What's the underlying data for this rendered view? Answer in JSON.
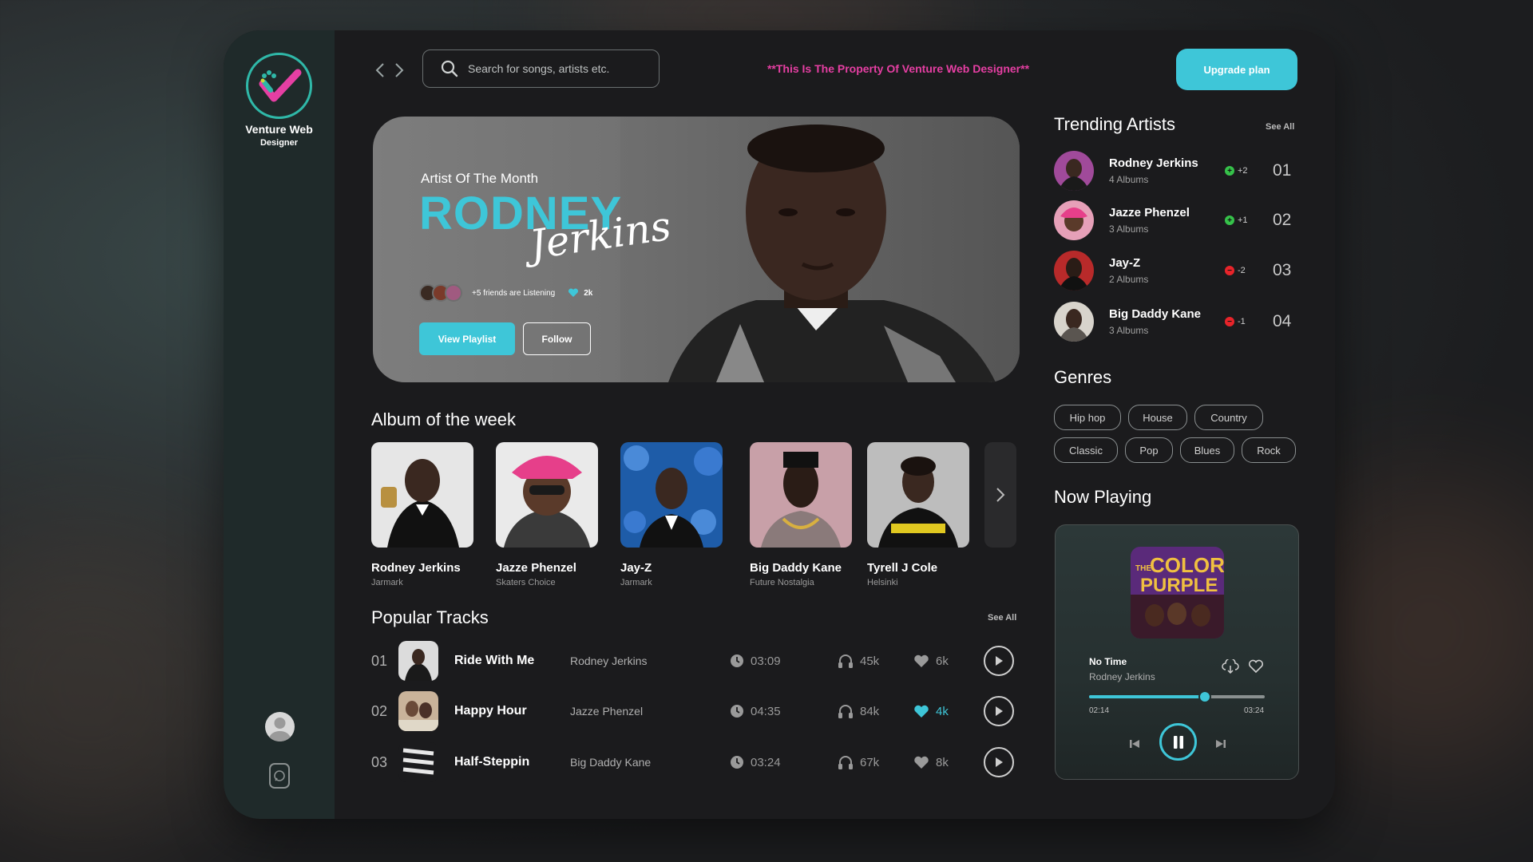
{
  "brand": {
    "name_line1": "Venture Web",
    "name_line2": "Designer"
  },
  "search": {
    "placeholder": "Search for songs, artists etc."
  },
  "property_note": "**This Is The Property Of Venture Web Designer**",
  "upgrade_label": "Upgrade plan",
  "hero": {
    "eyebrow": "Artist Of The Month",
    "name": "RODNEY",
    "script": "Jerkins",
    "friends_text": "+5 friends are Listening",
    "likes": "2k",
    "view_playlist": "View Playlist",
    "follow": "Follow"
  },
  "albums": {
    "title": "Album of the week",
    "items": [
      {
        "title": "Rodney Jerkins",
        "subtitle": "Jarmark"
      },
      {
        "title": "Jazze Phenzel",
        "subtitle": "Skaters Choice"
      },
      {
        "title": "Jay-Z",
        "subtitle": "Jarmark"
      },
      {
        "title": "Big Daddy Kane",
        "subtitle": "Future Nostalgia"
      },
      {
        "title": "Tyrell J Cole",
        "subtitle": "Helsinki"
      }
    ]
  },
  "tracks": {
    "title": "Popular Tracks",
    "see_all": "See All",
    "items": [
      {
        "num": "01",
        "title": "Ride With Me",
        "artist": "Rodney Jerkins",
        "duration": "03:09",
        "plays": "45k",
        "likes": "6k",
        "liked": false
      },
      {
        "num": "02",
        "title": "Happy Hour",
        "artist": "Jazze Phenzel",
        "duration": "04:35",
        "plays": "84k",
        "likes": "4k",
        "liked": true
      },
      {
        "num": "03",
        "title": "Half-Steppin",
        "artist": "Big Daddy Kane",
        "duration": "03:24",
        "plays": "67k",
        "likes": "8k",
        "liked": false
      }
    ]
  },
  "trending": {
    "title": "Trending Artists",
    "see_all": "See All",
    "items": [
      {
        "name": "Rodney Jerkins",
        "albums": "4 Albums",
        "change": "+2",
        "rank": "01",
        "up": true
      },
      {
        "name": "Jazze Phenzel",
        "albums": "3 Albums",
        "change": "+1",
        "rank": "02",
        "up": true
      },
      {
        "name": "Jay-Z",
        "albums": "2 Albums",
        "change": "-2",
        "rank": "03",
        "up": false
      },
      {
        "name": "Big Daddy Kane",
        "albums": "3 Albums",
        "change": "-1",
        "rank": "04",
        "up": false
      }
    ]
  },
  "genres": {
    "title": "Genres",
    "items": [
      "Hip hop",
      "House",
      "Country",
      "Classic",
      "Pop",
      "Blues",
      "Rock"
    ]
  },
  "now_playing": {
    "title": "Now Playing",
    "cover_text_1": "THE",
    "cover_text_2": "COLOR",
    "cover_text_3": "PURPLE",
    "song": "No Time",
    "artist": "Rodney Jerkins",
    "elapsed": "02:14",
    "total": "03:24",
    "progress": 0.66
  },
  "colors": {
    "accent": "#3ec6d8",
    "pink": "#e63fa3",
    "up": "#36c24a",
    "down": "#e8242a"
  },
  "icons": [
    "search-icon",
    "chevron-left-icon",
    "chevron-right-icon",
    "heart-icon",
    "clock-icon",
    "headphones-icon",
    "play-icon",
    "pause-icon",
    "skip-previous-icon",
    "skip-next-icon",
    "download-icon",
    "user-icon",
    "chat-icon"
  ]
}
